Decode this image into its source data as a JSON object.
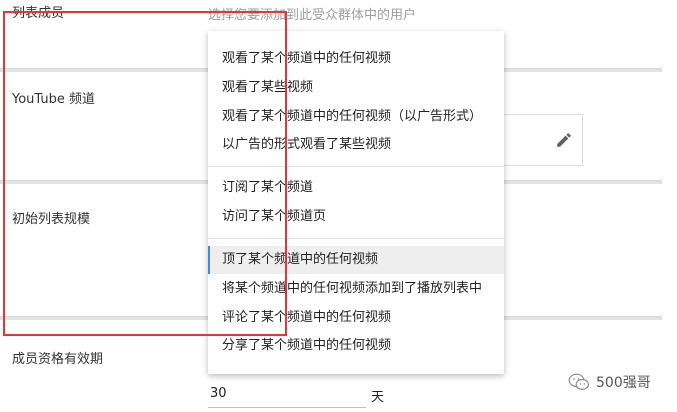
{
  "form": {
    "members_label": "列表成员",
    "members_placeholder": "选择您要添加到此受众群体中的用户",
    "channel_label": "YouTube 频道",
    "initial_size_label": "初始列表规模",
    "membership_label": "成员资格有效期",
    "membership_value": "30",
    "membership_unit": "天"
  },
  "dropdown": {
    "groups": [
      [
        "观看了某个频道中的任何视频",
        "观看了某些视频",
        "观看了某个频道中的任何视频（以广告形式）",
        "以广告的形式观看了某些视频"
      ],
      [
        "订阅了某个频道",
        "访问了某个频道页"
      ],
      [
        "顶了某个频道中的任何视频",
        "将某个频道中的任何视频添加到了播放列表中",
        "评论了某个频道中的任何视频",
        "分享了某个频道中的任何视频"
      ]
    ],
    "highlighted": "顶了某个频道中的任何视频"
  },
  "icons": {
    "edit": "pencil-icon",
    "watermark": "wechat-icon"
  },
  "colors": {
    "highlight_border": "#e0383a",
    "active_indicator": "#4285f4"
  },
  "watermark": {
    "text": "500强哥"
  }
}
